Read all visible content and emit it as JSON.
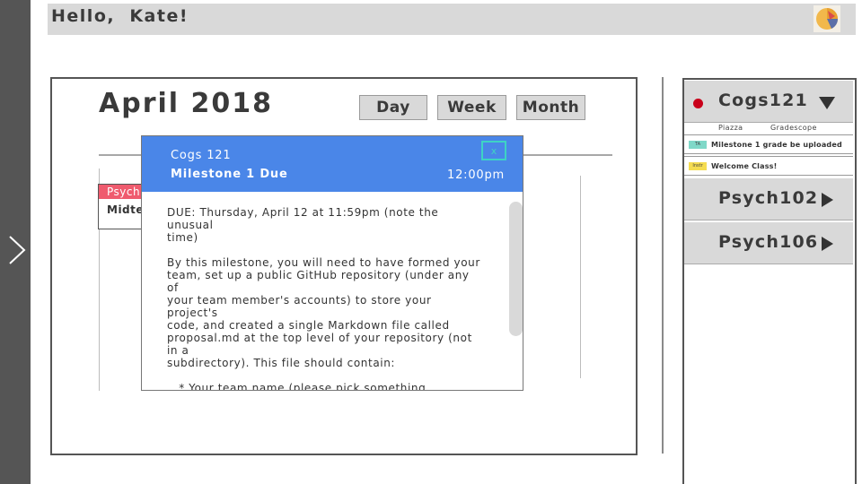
{
  "header": {
    "greeting": "Hello,  Kate!",
    "avatar_icon": "user-avatar-icon"
  },
  "calendar": {
    "month_title": "April 2018",
    "view_buttons": [
      "Day",
      "Week",
      "Month"
    ],
    "event": {
      "tag": "Psych",
      "text": "Midterm",
      "tag_color": "#ef5b6e"
    }
  },
  "modal": {
    "course": "Cogs 121",
    "event_title": "Milestone 1 Due",
    "time": "12:00pm",
    "close_label": "x",
    "header_color": "#4a86e8",
    "body": "DUE: Thursday, April 12 at 11:59pm (note the unusual\ntime)\n\nBy this milestone, you will need to have formed your\nteam, set up a public GitHub repository (under any of\nyour team member's accounts) to store your project's\ncode, and created a single Markdown file called\nproposal.md at the top level of your repository (not in a\nsubdirectory). This file should contain:\n\n   * Your team name (please pick something\n   memorable but family-friendly and appropriate)\n   * All of your team members' names (do not list"
  },
  "sidebar": {
    "courses": [
      {
        "name": "Cogs121",
        "expanded": true,
        "has_alert": true
      },
      {
        "name": "Psych102",
        "expanded": false
      },
      {
        "name": "Psych106",
        "expanded": false
      }
    ],
    "sublinks": [
      "Piazza",
      "Gradescope"
    ],
    "notifications": [
      {
        "tag": "TA",
        "text": "Milestone 1 grade be uploaded",
        "color": "#7fd8c8"
      },
      {
        "tag": "Instr",
        "text": "Welcome Class!",
        "color": "#f5dc50"
      }
    ],
    "alert_color": "#c9001a"
  }
}
